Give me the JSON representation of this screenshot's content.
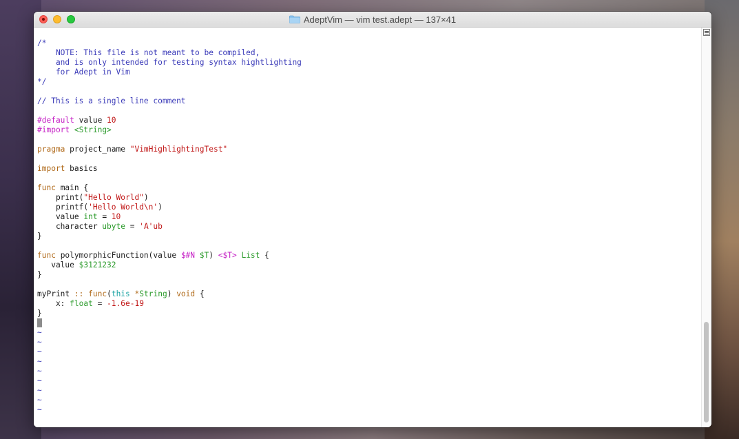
{
  "window": {
    "title": "AdeptVim — vim test.adept — 137×41"
  },
  "editor": {
    "lines": [
      [
        {
          "t": "/*",
          "c": "c-comment"
        }
      ],
      [
        {
          "t": "    NOTE: This file is not meant to be compiled,",
          "c": "c-comment"
        }
      ],
      [
        {
          "t": "    and is only intended for testing syntax hightlighting",
          "c": "c-comment"
        }
      ],
      [
        {
          "t": "    for Adept in Vim",
          "c": "c-comment"
        }
      ],
      [
        {
          "t": "*/",
          "c": "c-comment"
        }
      ],
      [],
      [
        {
          "t": "// This is a single line comment",
          "c": "c-comment"
        }
      ],
      [],
      [
        {
          "t": "#default",
          "c": "c-pre"
        },
        {
          "t": " value "
        },
        {
          "t": "10",
          "c": "c-num"
        }
      ],
      [
        {
          "t": "#import",
          "c": "c-pre"
        },
        {
          "t": " "
        },
        {
          "t": "<String>",
          "c": "c-type"
        }
      ],
      [],
      [
        {
          "t": "pragma",
          "c": "c-kw"
        },
        {
          "t": " project_name "
        },
        {
          "t": "\"VimHighlightingTest\"",
          "c": "c-str"
        }
      ],
      [],
      [
        {
          "t": "import",
          "c": "c-kw"
        },
        {
          "t": " basics"
        }
      ],
      [],
      [
        {
          "t": "func",
          "c": "c-kw"
        },
        {
          "t": " main {"
        }
      ],
      [
        {
          "t": "    print("
        },
        {
          "t": "\"Hello World\"",
          "c": "c-str"
        },
        {
          "t": ")"
        }
      ],
      [
        {
          "t": "    printf("
        },
        {
          "t": "'Hello World\\n'",
          "c": "c-str"
        },
        {
          "t": ")"
        }
      ],
      [
        {
          "t": "    value "
        },
        {
          "t": "int",
          "c": "c-type"
        },
        {
          "t": " = "
        },
        {
          "t": "10",
          "c": "c-num"
        }
      ],
      [
        {
          "t": "    character "
        },
        {
          "t": "ubyte",
          "c": "c-type"
        },
        {
          "t": " = "
        },
        {
          "t": "'A'ub",
          "c": "c-str"
        }
      ],
      [
        {
          "t": "}"
        }
      ],
      [],
      [
        {
          "t": "func",
          "c": "c-kw"
        },
        {
          "t": " polymorphicFunction(value "
        },
        {
          "t": "$#N",
          "c": "c-pre"
        },
        {
          "t": " "
        },
        {
          "t": "$T",
          "c": "c-type"
        },
        {
          "t": ") "
        },
        {
          "t": "<$T>",
          "c": "c-pre"
        },
        {
          "t": " "
        },
        {
          "t": "List",
          "c": "c-type"
        },
        {
          "t": " {"
        }
      ],
      [
        {
          "t": "   value "
        },
        {
          "t": "$3121232",
          "c": "c-type"
        }
      ],
      [
        {
          "t": "}"
        }
      ],
      [],
      [
        {
          "t": "myPrint "
        },
        {
          "t": "::",
          "c": "c-kw"
        },
        {
          "t": " "
        },
        {
          "t": "func",
          "c": "c-kw"
        },
        {
          "t": "("
        },
        {
          "t": "this",
          "c": "c-this"
        },
        {
          "t": " "
        },
        {
          "t": "*",
          "c": "c-kw"
        },
        {
          "t": "String",
          "c": "c-type"
        },
        {
          "t": ") "
        },
        {
          "t": "void",
          "c": "c-kw"
        },
        {
          "t": " {"
        }
      ],
      [
        {
          "t": "    x: "
        },
        {
          "t": "float",
          "c": "c-type"
        },
        {
          "t": " = "
        },
        {
          "t": "-1.6e-19",
          "c": "c-num"
        }
      ],
      [
        {
          "t": "}"
        }
      ],
      [
        {
          "cursor": true
        }
      ],
      [
        {
          "t": "~",
          "c": "c-tilde"
        }
      ],
      [
        {
          "t": "~",
          "c": "c-tilde"
        }
      ],
      [
        {
          "t": "~",
          "c": "c-tilde"
        }
      ],
      [
        {
          "t": "~",
          "c": "c-tilde"
        }
      ],
      [
        {
          "t": "~",
          "c": "c-tilde"
        }
      ],
      [
        {
          "t": "~",
          "c": "c-tilde"
        }
      ],
      [
        {
          "t": "~",
          "c": "c-tilde"
        }
      ],
      [
        {
          "t": "~",
          "c": "c-tilde"
        }
      ],
      [
        {
          "t": "~",
          "c": "c-tilde"
        }
      ]
    ]
  },
  "colors": {
    "comment": "#3a3ab8",
    "preprocessor": "#c520c5",
    "string_number": "#c01515",
    "keyword": "#b06a1a",
    "type": "#2a9a2a"
  },
  "icons": {
    "title": "folder-icon",
    "scroll_top": "list-icon"
  }
}
